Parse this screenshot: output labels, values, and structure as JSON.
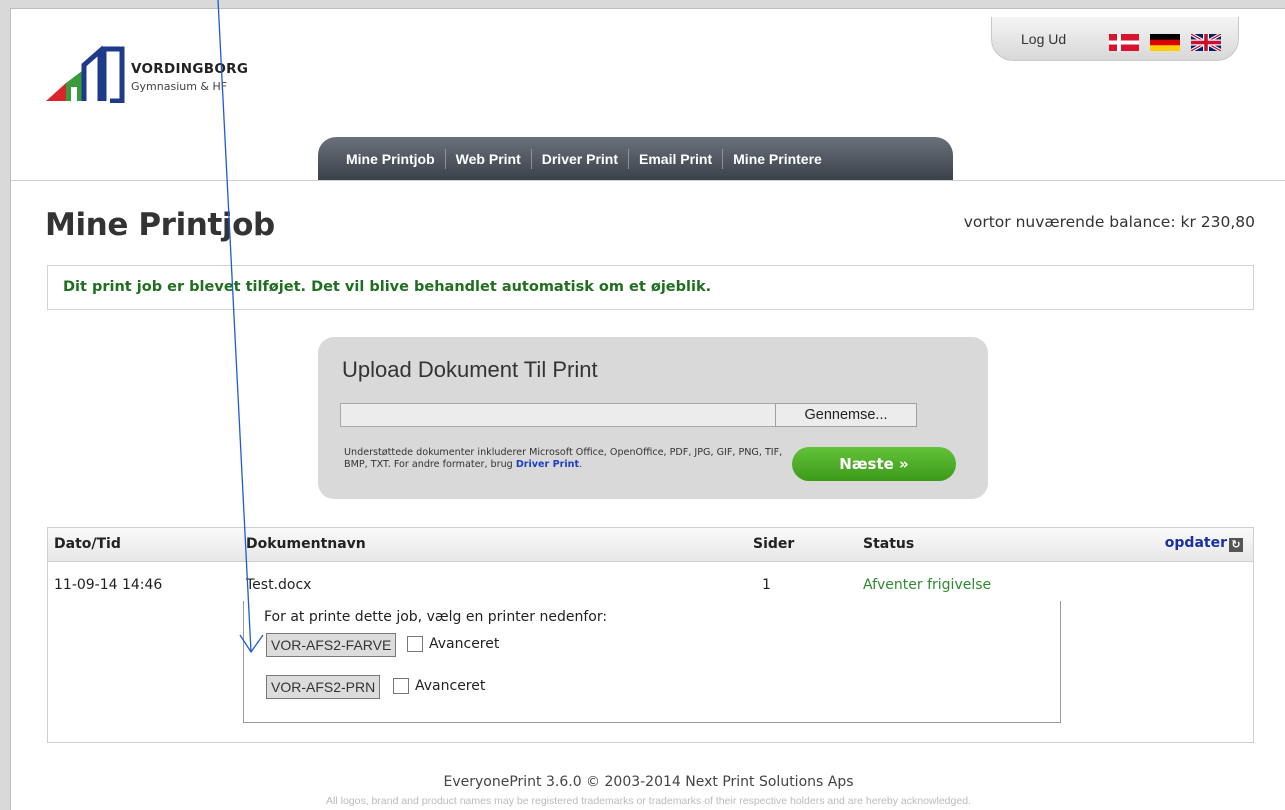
{
  "header": {
    "logo_name": "VORDINGBORG",
    "logo_sub": "Gymnasium & HF",
    "logout_label": "Log Ud",
    "languages": [
      "danish-flag",
      "german-flag",
      "uk-flag"
    ]
  },
  "nav": {
    "items": [
      "Mine Printjob",
      "Web Print",
      "Driver Print",
      "Email Print",
      "Mine Printere"
    ]
  },
  "page": {
    "title": "Mine Printjob",
    "balance": "vortor nuværende balance: kr 230,80",
    "notice": "Dit print job er blevet tilføjet. Det vil blive behandlet automatisk om et øjeblik."
  },
  "upload": {
    "title": "Upload Dokument Til Print",
    "file_value": "",
    "browse_label": "Gennemse...",
    "supported_text": "Understøttede dokumenter inkluderer Microsoft Office, OpenOffice, PDF, JPG, GIF, PNG, TIF, BMP, TXT. For andre formater, brug ",
    "supported_link": "Driver Print",
    "supported_end": ".",
    "next_label": "Næste »"
  },
  "jobs": {
    "headers": {
      "date": "Dato/Tid",
      "doc": "Dokumentnavn",
      "pages": "Sider",
      "status": "Status",
      "refresh": "opdater"
    },
    "rows": [
      {
        "date": "11-09-14 14:46",
        "doc": "Test.docx",
        "pages": "1",
        "status": "Afventer frigivelse"
      }
    ],
    "printer_prompt": "For at printe dette job, vælg en printer nedenfor:",
    "printers": [
      {
        "name": "VOR-AFS2-FARVE",
        "advanced_label": "Avanceret"
      },
      {
        "name": "VOR-AFS2-PRN",
        "advanced_label": "Avanceret"
      }
    ]
  },
  "footer": {
    "line1": "EveryonePrint 3.6.0 © 2003-2014 Next Print Solutions Aps",
    "line2": "All logos, brand and product names may be registered trademarks or trademarks of their respective holders and are hereby acknowledged."
  },
  "colors": {
    "nav_bg": "#4b515a",
    "notice_text": "#1f6f1f",
    "status_green": "#2f8a2f",
    "next_button": "#4caf27",
    "annotation_arrow": "#1f5bd6",
    "logo_red": "#d9262b",
    "logo_green": "#3a9b3a",
    "logo_blue": "#1f3a8a"
  }
}
